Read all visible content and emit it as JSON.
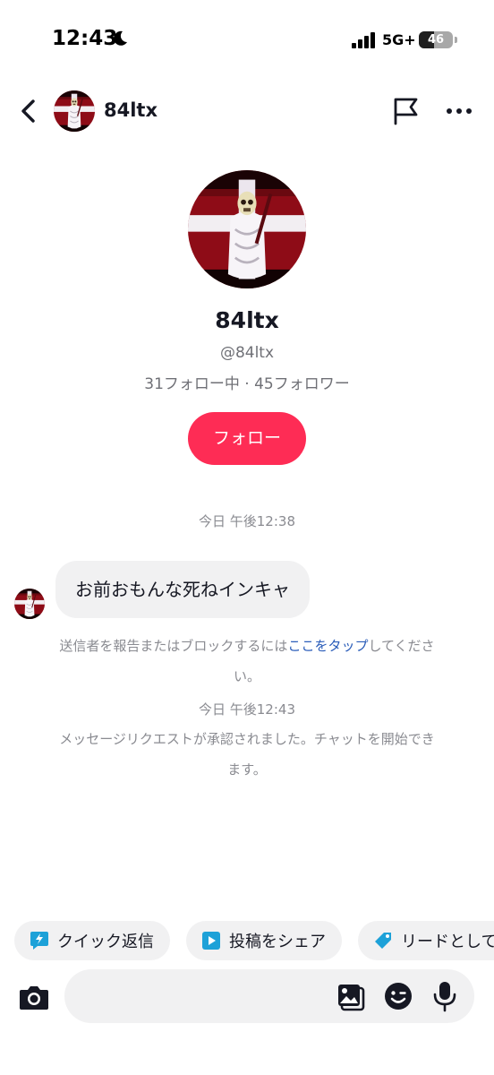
{
  "status_bar": {
    "time": "12:43",
    "network": "5G+",
    "battery": "46",
    "battery_level": 0.46,
    "icons": [
      "moon-icon",
      "signal-icon",
      "battery-icon"
    ]
  },
  "header": {
    "username": "84ltx",
    "icons": [
      "back-icon",
      "flag-icon",
      "more-icon"
    ]
  },
  "profile": {
    "display_name": "84ltx",
    "handle": "@84ltx",
    "stats": "31フォロー中 · 45フォロワー",
    "follow_label": "フォロー"
  },
  "conversation": {
    "timestamp_1": "今日 午後12:38",
    "message_text": "お前おもんな死ねインキャ",
    "report_notice_before": "送信者を報告またはブロックするには",
    "report_notice_link": "ここをタップ",
    "report_notice_after": "してください。",
    "timestamp_2": "今日 午後12:43",
    "accept_notice": "メッセージリクエストが承認されました。チャットを開始できます。"
  },
  "quick_actions": [
    {
      "label": "クイック返信",
      "icon": "lightning-bubble-icon"
    },
    {
      "label": "投稿をシェア",
      "icon": "play-icon"
    },
    {
      "label": "リードとして",
      "icon": "tag-icon"
    }
  ],
  "composer": {
    "placeholder": "",
    "icons": [
      "camera-icon",
      "gallery-icon",
      "emoji-icon",
      "mic-icon"
    ]
  },
  "colors": {
    "accent": "#fe2c55",
    "link": "#2b5db9",
    "chip_icon": "#1da1d8",
    "bubble": "#f1f1f2"
  }
}
